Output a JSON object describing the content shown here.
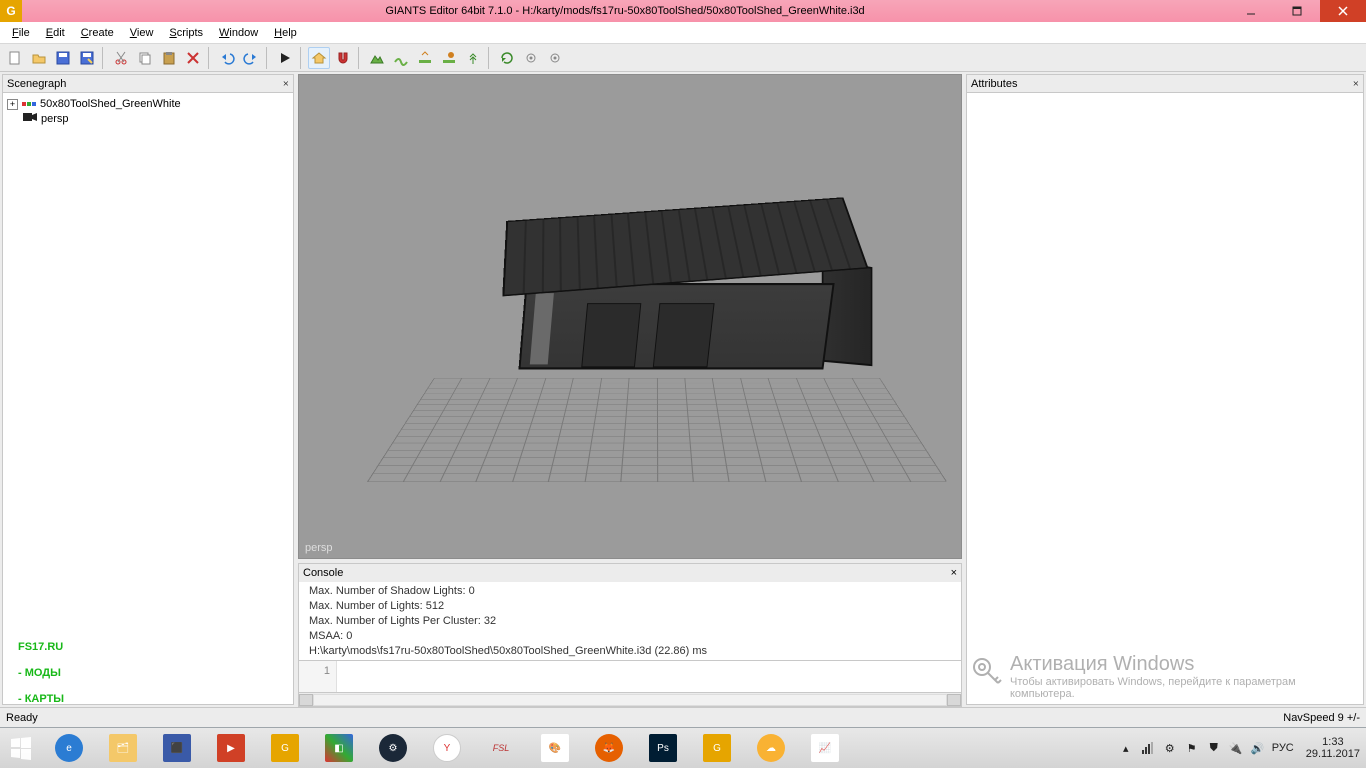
{
  "titlebar": {
    "title": "GIANTS Editor 64bit 7.1.0 - H:/karty/mods/fs17ru-50x80ToolShed/50x80ToolShed_GreenWhite.i3d"
  },
  "menus": {
    "file": "File",
    "edit": "Edit",
    "create": "Create",
    "view": "View",
    "scripts": "Scripts",
    "window": "Window",
    "help": "Help"
  },
  "scenegraph": {
    "title": "Scenegraph",
    "root": "50x80ToolShed_GreenWhite",
    "persp": "persp"
  },
  "attributes": {
    "title": "Attributes"
  },
  "viewport": {
    "camera": "persp"
  },
  "console": {
    "title": "Console",
    "lines": [
      "Max. Number of Shadow Lights: 0",
      "Max. Number of Lights: 512",
      "Max. Number of Lights Per Cluster: 32",
      "MSAA: 0",
      "H:\\karty\\mods\\fs17ru-50x80ToolShed\\50x80ToolShed_GreenWhite.i3d (22.86) ms"
    ],
    "lineno": "1"
  },
  "statusbar": {
    "ready": "Ready",
    "navspeed": "NavSpeed 9 +/-"
  },
  "watermark": {
    "l1": "FS17.RU",
    "l2": "- МОДЫ",
    "l3": "- КАРТЫ"
  },
  "winact": {
    "h": "Активация Windows",
    "s": "Чтобы активировать Windows, перейдите к параметрам компьютера."
  },
  "taskbar": {
    "lang": "РУС",
    "time": "1:33",
    "date": "29.11.2017"
  },
  "colors": {
    "accent": "#f7a5b8",
    "close": "#d04026",
    "ground": "#9b9b9b"
  }
}
